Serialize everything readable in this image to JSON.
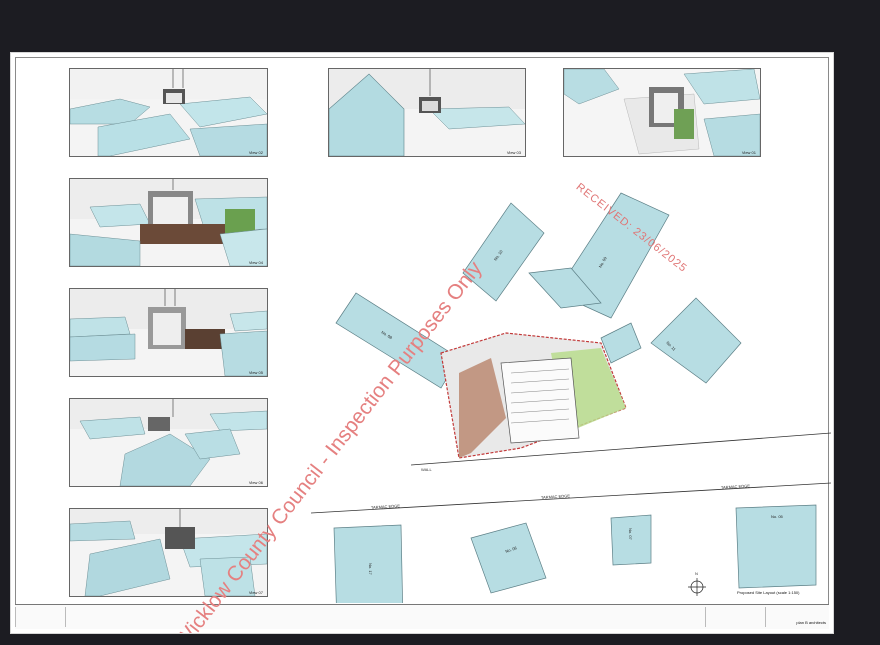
{
  "stamp": {
    "received": "RECEIVED: 23/06/2025",
    "council": "Wicklow County Council - Inspection Purposes Only"
  },
  "views": {
    "v02": "View 02",
    "v03": "View 03",
    "v01": "View 01",
    "v04": "View 04",
    "v05": "View 05",
    "v06": "View 06",
    "v07": "View 07"
  },
  "plan": {
    "title": "Proposed Site Layout (scale 1:150)",
    "road_left": "TARMAC EDGE",
    "road_mid": "TARMAC EDGE",
    "road_right": "TARMAC EDGE",
    "wall": "WALL",
    "plots": {
      "no10": "No. 10",
      "no09": "No. 09",
      "no08": "No. 08",
      "no11": "No. 11",
      "no17": "No. 17",
      "no06": "No. 06",
      "no07": "No. 07",
      "no05": "No. 05"
    },
    "north": "N"
  },
  "title_block": {
    "brand": "plan B architects"
  }
}
